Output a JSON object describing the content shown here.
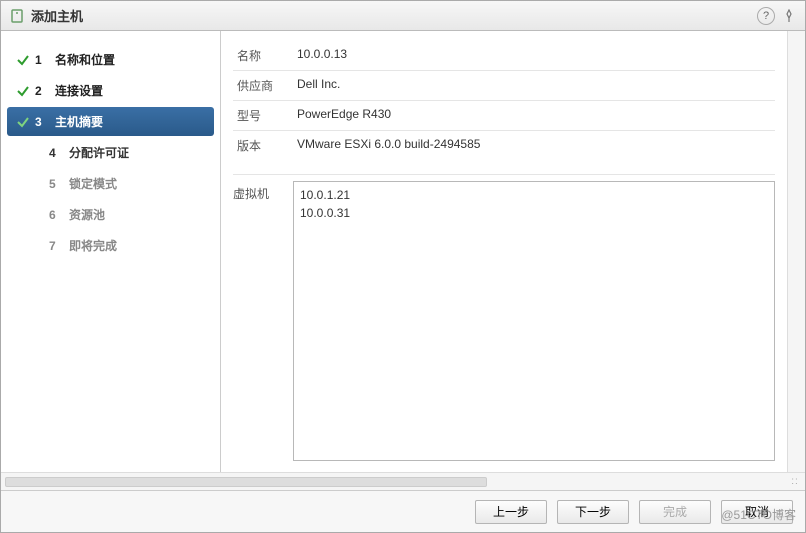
{
  "titlebar": {
    "title": "添加主机"
  },
  "steps": [
    {
      "num": "1",
      "label": "名称和位置",
      "state": "done"
    },
    {
      "num": "2",
      "label": "连接设置",
      "state": "done"
    },
    {
      "num": "3",
      "label": "主机摘要",
      "state": "active"
    },
    {
      "num": "4",
      "label": "分配许可证",
      "state": "next"
    },
    {
      "num": "5",
      "label": "锁定模式",
      "state": "pending"
    },
    {
      "num": "6",
      "label": "资源池",
      "state": "pending"
    },
    {
      "num": "7",
      "label": "即将完成",
      "state": "pending"
    }
  ],
  "summary": {
    "name_label": "名称",
    "name_value": "10.0.0.13",
    "vendor_label": "供应商",
    "vendor_value": "Dell Inc.",
    "model_label": "型号",
    "model_value": "PowerEdge R430",
    "version_label": "版本",
    "version_value": "VMware ESXi 6.0.0 build-2494585"
  },
  "vmpanel": {
    "label": "虚拟机",
    "vms": [
      "10.0.1.21",
      "10.0.0.31"
    ]
  },
  "footer": {
    "back": "上一步",
    "next": "下一步",
    "finish": "完成",
    "cancel": "取消"
  },
  "watermark": "@51CTO博客"
}
